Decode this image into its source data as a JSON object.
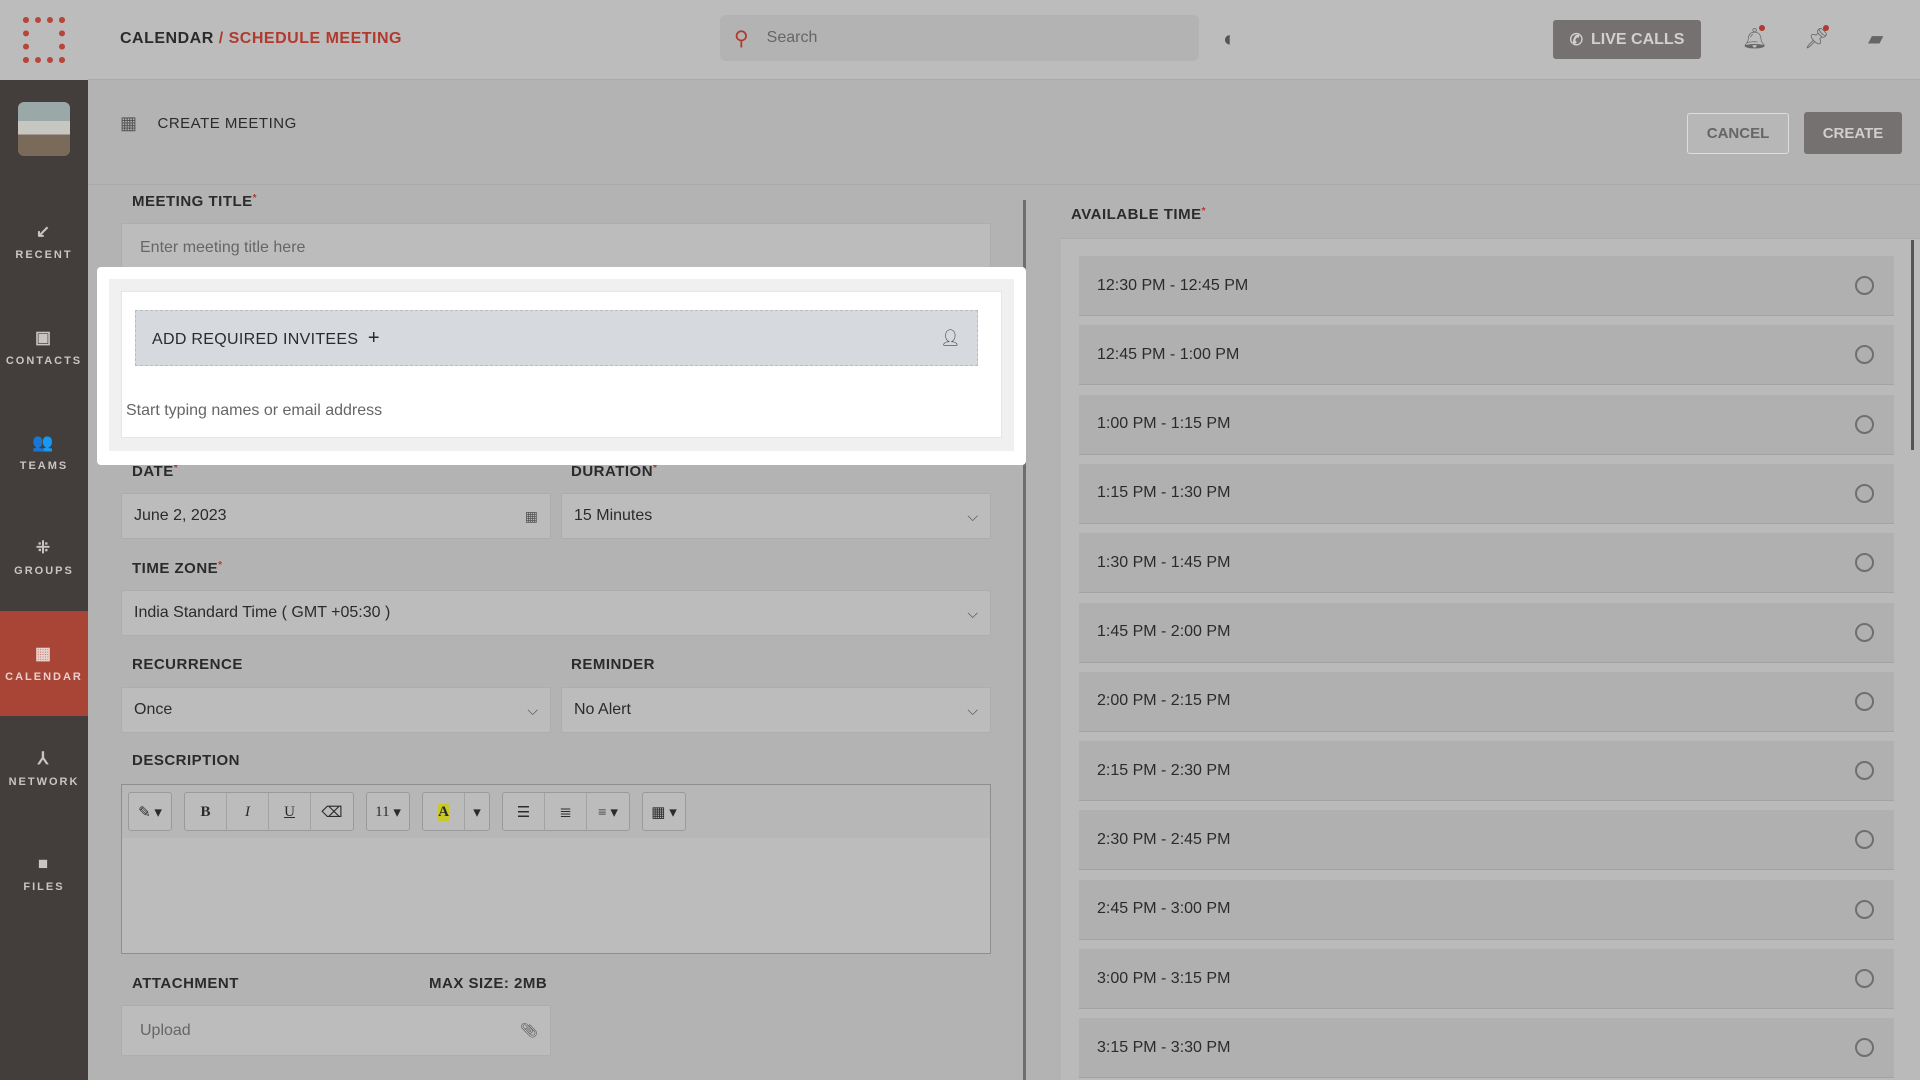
{
  "header": {
    "breadcrumb_root": "CALENDAR",
    "breadcrumb_sep": " / ",
    "breadcrumb_current": "SCHEDULE MEETING",
    "search_placeholder": "Search",
    "live_calls": "LIVE CALLS"
  },
  "sidebar": {
    "items": [
      {
        "label": "RECENT",
        "icon": "↙"
      },
      {
        "label": "CONTACTS",
        "icon": "▣"
      },
      {
        "label": "TEAMS",
        "icon": "👥"
      },
      {
        "label": "GROUPS",
        "icon": "⁜"
      },
      {
        "label": "CALENDAR",
        "icon": "▦",
        "active": true
      },
      {
        "label": "NETWORK",
        "icon": "⅄"
      },
      {
        "label": "FILES",
        "icon": "■"
      }
    ]
  },
  "page": {
    "title": "CREATE MEETING",
    "cancel": "CANCEL",
    "create": "CREATE"
  },
  "form": {
    "meeting_title_label": "MEETING TITLE",
    "meeting_title_placeholder": "Enter meeting title here",
    "invitees_label": "ADD REQUIRED INVITEES",
    "invitees_plus": "+",
    "invitees_placeholder": "Start typing names or email address",
    "date_label": "DATE",
    "date_value": "June 2, 2023",
    "duration_label": "DURATION",
    "duration_value": "15 Minutes",
    "timezone_label": "TIME ZONE",
    "timezone_value": "India Standard Time ( GMT +05:30 )",
    "recurrence_label": "RECURRENCE",
    "recurrence_value": "Once",
    "reminder_label": "REMINDER",
    "reminder_value": "No Alert",
    "description_label": "DESCRIPTION",
    "font_size": "11",
    "attachment_label": "ATTACHMENT",
    "max_size": "MAX SIZE: 2MB",
    "upload_placeholder": "Upload",
    "required_mark": "*"
  },
  "available_time": {
    "label": "AVAILABLE TIME",
    "slots": [
      "12:30 PM - 12:45 PM",
      "12:45 PM - 1:00 PM",
      "1:00 PM - 1:15 PM",
      "1:15 PM - 1:30 PM",
      "1:30 PM - 1:45 PM",
      "1:45 PM - 2:00 PM",
      "2:00 PM - 2:15 PM",
      "2:15 PM - 2:30 PM",
      "2:30 PM - 2:45 PM",
      "2:45 PM - 3:00 PM",
      "3:00 PM - 3:15 PM",
      "3:15 PM - 3:30 PM"
    ]
  },
  "colors": {
    "accent": "#b03a2e",
    "sidebar": "#433d3b",
    "active_nav": "#a84536"
  }
}
